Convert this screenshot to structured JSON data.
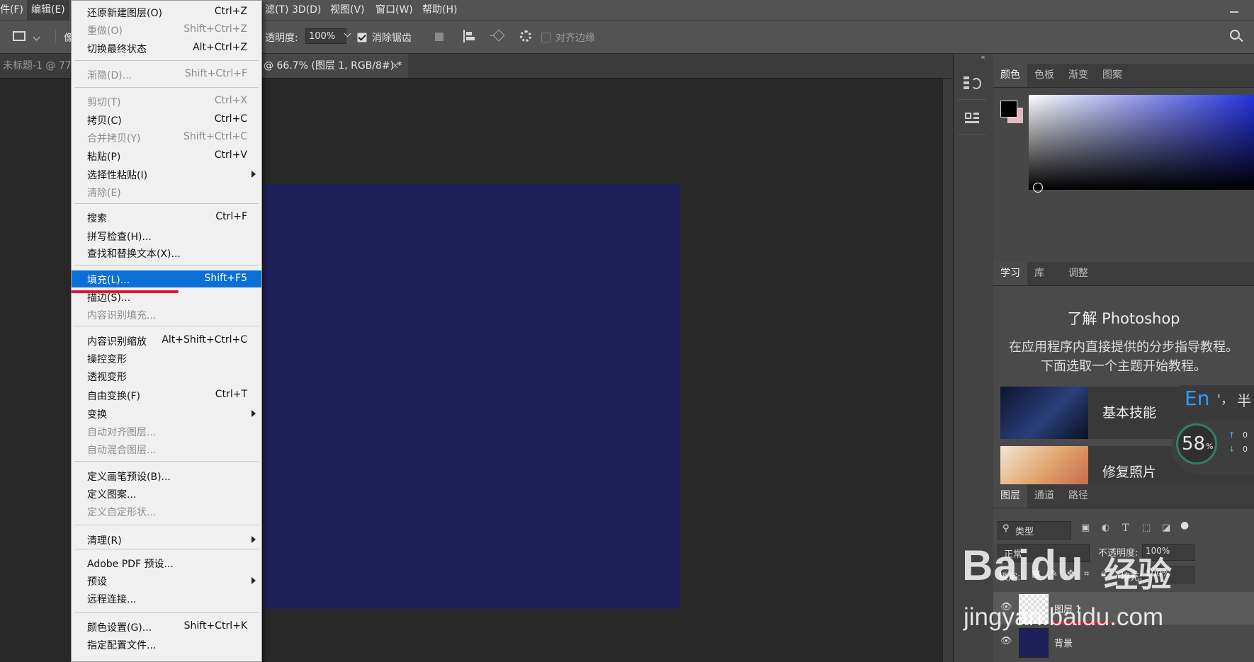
{
  "menubar": {
    "items": [
      "件(F)",
      "编辑(E)",
      "滤(T)",
      "3D(D)",
      "视图(V)",
      "窗口(W)",
      "帮助(H)"
    ]
  },
  "options_bar": {
    "truncated_label": "像",
    "opacity_label": "透明度:",
    "opacity_value": "100%",
    "antialias_label": "消除锯齿",
    "align_edges_label": "对齐边缘"
  },
  "tabs": {
    "left_tab": "未标题-1 @ 77",
    "active_tab": "@ 66.7% (图层 1, RGB/8#) *",
    "close": "×"
  },
  "edit_menu": {
    "items": [
      {
        "label": "还原新建图层(O)",
        "shortcut": "Ctrl+Z",
        "disabled": false
      },
      {
        "label": "重做(O)",
        "shortcut": "Shift+Ctrl+Z",
        "disabled": true
      },
      {
        "label": "切换最终状态",
        "shortcut": "Alt+Ctrl+Z",
        "disabled": false
      },
      {
        "label": "渐隐(D)...",
        "shortcut": "Shift+Ctrl+F",
        "disabled": true
      },
      {
        "label": "剪切(T)",
        "shortcut": "Ctrl+X",
        "disabled": true
      },
      {
        "label": "拷贝(C)",
        "shortcut": "Ctrl+C",
        "disabled": false
      },
      {
        "label": "合并拷贝(Y)",
        "shortcut": "Shift+Ctrl+C",
        "disabled": true
      },
      {
        "label": "粘贴(P)",
        "shortcut": "Ctrl+V",
        "disabled": false
      },
      {
        "label": "选择性粘贴(I)",
        "shortcut": "",
        "disabled": false
      },
      {
        "label": "清除(E)",
        "shortcut": "",
        "disabled": true
      },
      {
        "label": "搜索",
        "shortcut": "Ctrl+F",
        "disabled": false
      },
      {
        "label": "拼写检查(H)...",
        "shortcut": "",
        "disabled": false
      },
      {
        "label": "查找和替换文本(X)...",
        "shortcut": "",
        "disabled": false
      },
      {
        "label": "填充(L)...",
        "shortcut": "Shift+F5",
        "disabled": false
      },
      {
        "label": "描边(S)...",
        "shortcut": "",
        "disabled": false
      },
      {
        "label": "内容识别填充...",
        "shortcut": "",
        "disabled": true
      },
      {
        "label": "内容识别缩放",
        "shortcut": "Alt+Shift+Ctrl+C",
        "disabled": false
      },
      {
        "label": "操控变形",
        "shortcut": "",
        "disabled": false
      },
      {
        "label": "透视变形",
        "shortcut": "",
        "disabled": false
      },
      {
        "label": "自由变换(F)",
        "shortcut": "Ctrl+T",
        "disabled": false
      },
      {
        "label": "变换",
        "shortcut": "",
        "disabled": false
      },
      {
        "label": "自动对齐图层...",
        "shortcut": "",
        "disabled": true
      },
      {
        "label": "自动混合图层...",
        "shortcut": "",
        "disabled": true
      },
      {
        "label": "定义画笔预设(B)...",
        "shortcut": "",
        "disabled": false
      },
      {
        "label": "定义图案...",
        "shortcut": "",
        "disabled": false
      },
      {
        "label": "定义自定形状...",
        "shortcut": "",
        "disabled": true
      },
      {
        "label": "清理(R)",
        "shortcut": "",
        "disabled": false
      },
      {
        "label": "Adobe PDF 预设...",
        "shortcut": "",
        "disabled": false
      },
      {
        "label": "预设",
        "shortcut": "",
        "disabled": false
      },
      {
        "label": "远程连接...",
        "shortcut": "",
        "disabled": false
      },
      {
        "label": "颜色设置(G)...",
        "shortcut": "Shift+Ctrl+K",
        "disabled": false
      },
      {
        "label": "指定配置文件...",
        "shortcut": "",
        "disabled": false
      }
    ],
    "highlighted": "填充(L)..."
  },
  "color_panel": {
    "tabs": [
      "颜色",
      "色板",
      "渐变",
      "图案"
    ],
    "foreground": "#000000",
    "background": "#e7b8c0",
    "hue": "#2433e0"
  },
  "learn_panel": {
    "tabs": [
      "学习",
      "库",
      "调整"
    ],
    "title": "了解 Photoshop",
    "desc_line1": "在应用程序内直接提供的分步指导教程。",
    "desc_line2": "下面选取一个主题开始教程。",
    "cards": [
      "基本技能",
      "修复照片"
    ]
  },
  "ime": {
    "lang": "En",
    "punct": "'，",
    "width": "半"
  },
  "meter": {
    "value": "58",
    "unit": "%",
    "up": "0",
    "down": "0"
  },
  "layers_panel": {
    "tabs": [
      "图层",
      "通道",
      "路径"
    ],
    "filter_label": "类型",
    "blend_mode": "正常",
    "opacity_label": "不透明度:",
    "opacity_value": "100%",
    "lock_label": "锁定:",
    "fill_label": "填充:",
    "fill_value": "100%",
    "layers": [
      {
        "name": "图层 1",
        "selected": true
      },
      {
        "name": "背景",
        "selected": false
      }
    ]
  },
  "watermark": {
    "brand": "Baidu",
    "suffix": "经验",
    "url": "jingyan.baidu.com"
  }
}
